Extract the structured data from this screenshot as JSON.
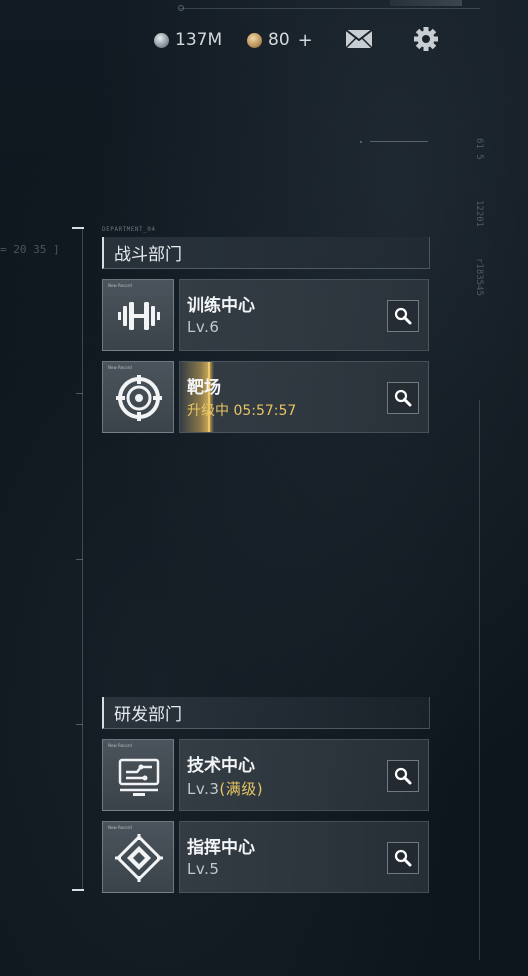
{
  "resources": {
    "silver": {
      "icon": "silver-coin-icon",
      "value": "137M"
    },
    "gold": {
      "icon": "gold-coin-icon",
      "value": "80",
      "add": "+"
    }
  },
  "toolbar": {
    "mail_icon": "mail-icon",
    "settings_icon": "gear-icon"
  },
  "decor": {
    "department_tag": "DEPARTMENT_04",
    "side_left_code": "= 20 35 ]",
    "side_right_code": "61 5",
    "side_right_code2": "12201",
    "side_right_code3": "r183545"
  },
  "departments": [
    {
      "title": "战斗部门",
      "facilities": [
        {
          "name": "训练中心",
          "level": "Lv.6",
          "icon": "dumbbell-icon",
          "mini": "New Record"
        },
        {
          "name": "靶场",
          "status": "升级中 05:57:57",
          "icon": "target-icon",
          "mini": "New Record",
          "upgrading": true
        }
      ]
    },
    {
      "title": "研发部门",
      "facilities": [
        {
          "name": "技术中心",
          "level": "Lv.3",
          "level_note": "(满级)",
          "icon": "tech-circuit-icon",
          "mini": "New Record"
        },
        {
          "name": "指挥中心",
          "level": "Lv.5",
          "icon": "command-emblem-icon",
          "mini": "New Record"
        }
      ]
    }
  ],
  "colors": {
    "accent_gold": "#e8c563",
    "panel": "#3e464e",
    "background": "#0e161d"
  }
}
